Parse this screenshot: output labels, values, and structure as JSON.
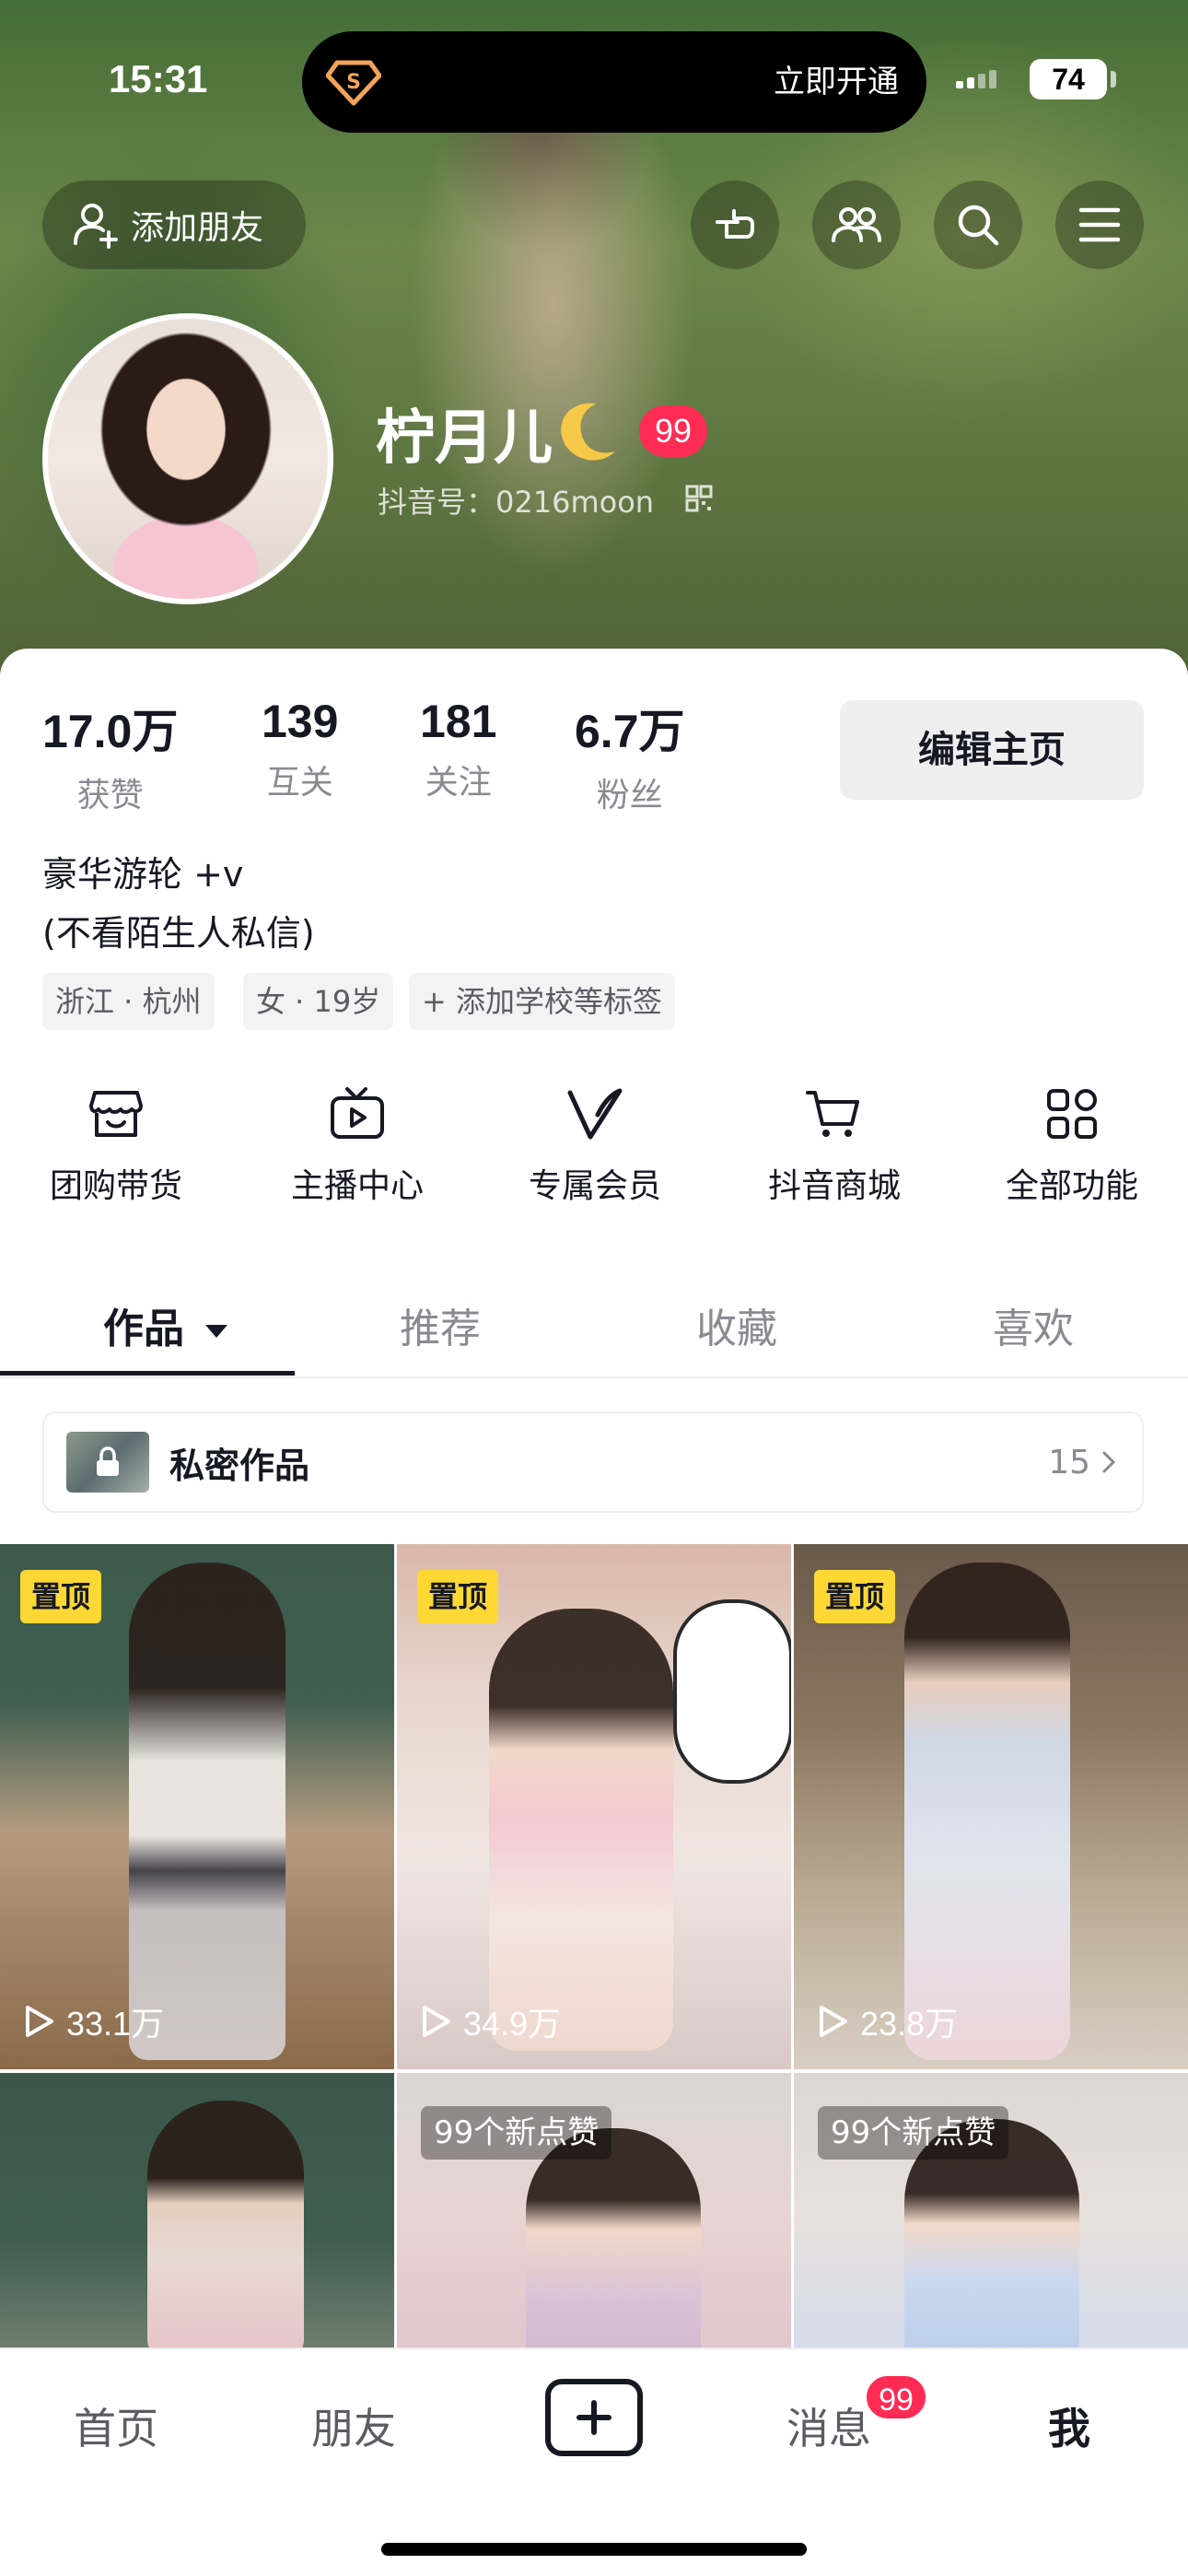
{
  "status_bar": {
    "time": "15:31",
    "battery": "74"
  },
  "island": {
    "action": "立即开通"
  },
  "header": {
    "add_friend": "添加朋友",
    "nickname": "柠月儿",
    "level": "99",
    "douyin_id": "抖音号：0216moon"
  },
  "stats": [
    {
      "value": "17.0万",
      "label": "获赞"
    },
    {
      "value": "139",
      "label": "互关"
    },
    {
      "value": "181",
      "label": "关注"
    },
    {
      "value": "6.7万",
      "label": "粉丝"
    }
  ],
  "edit_profile": "编辑主页",
  "bio": {
    "line1": "豪华游轮 +v",
    "line2": "(不看陌生人私信)"
  },
  "tags": [
    "浙江 · 杭州",
    "女 · 19岁",
    "+ 添加学校等标签"
  ],
  "tools": [
    {
      "label": "团购带货",
      "icon": "shop-icon"
    },
    {
      "label": "主播中心",
      "icon": "tv-icon"
    },
    {
      "label": "专属会员",
      "icon": "vip-icon"
    },
    {
      "label": "抖音商城",
      "icon": "cart-icon"
    },
    {
      "label": "全部功能",
      "icon": "grid-icon"
    }
  ],
  "tabs": [
    "作品",
    "推荐",
    "收藏",
    "喜欢"
  ],
  "private": {
    "label": "私密作品",
    "count": "15"
  },
  "videos": [
    {
      "pin": "置顶",
      "plays": "33.1万"
    },
    {
      "pin": "置顶",
      "plays": "34.9万"
    },
    {
      "pin": "置顶",
      "plays": "23.8万"
    },
    {
      "likes": ""
    },
    {
      "likes": "99个新点赞"
    },
    {
      "likes": "99个新点赞"
    }
  ],
  "bottom_nav": [
    "首页",
    "朋友",
    "消息",
    "我"
  ],
  "message_badge": "99",
  "colors": {
    "accent": "#fe2c55",
    "pin": "#fdd835",
    "text": "#161823",
    "secondary": "#8a8b91"
  }
}
